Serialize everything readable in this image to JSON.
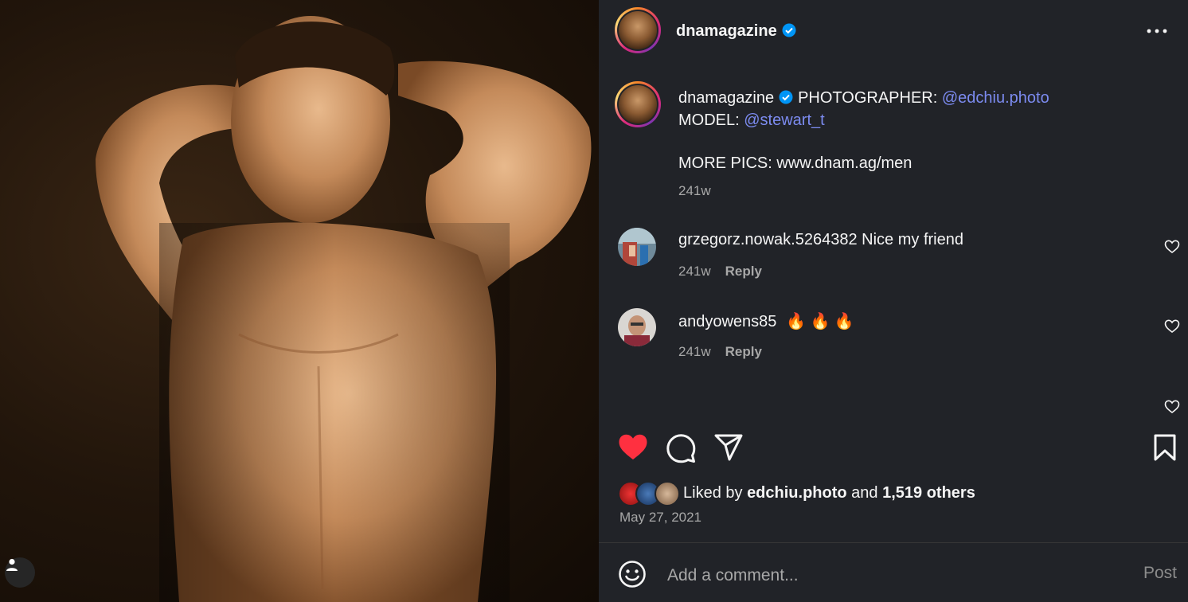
{
  "post": {
    "username": "dnamagazine",
    "verified": true
  },
  "caption": {
    "username": "dnamagazine",
    "photographer_label": "PHOTOGRAPHER:",
    "photographer_handle": "@edchiu.photo",
    "model_label": "MODEL:",
    "model_handle": "@stewart_t",
    "more_pics": "MORE PICS: www.dnam.ag/men",
    "age": "241w"
  },
  "comments": [
    {
      "username": "grzegorz.nowak.5264382",
      "text": "Nice my friend",
      "age": "241w",
      "reply_label": "Reply"
    },
    {
      "username": "andyowens85",
      "text": "🔥 🔥 🔥",
      "age": "241w",
      "reply_label": "Reply"
    }
  ],
  "likes": {
    "prefix": "Liked by",
    "liker": "edchiu.photo",
    "conjunction": "and",
    "others": "1,519 others"
  },
  "date": "May 27, 2021",
  "composer": {
    "placeholder": "Add a comment...",
    "post_label": "Post"
  },
  "colors": {
    "panel_bg": "#212328",
    "link": "#7c8bf0",
    "like_red": "#ff3040",
    "verified_blue": "#0095f6"
  },
  "icons": [
    "more-icon",
    "verified-icon",
    "heart-icon",
    "comment-icon",
    "share-icon",
    "bookmark-icon",
    "emoji-icon",
    "user-tag-icon"
  ]
}
